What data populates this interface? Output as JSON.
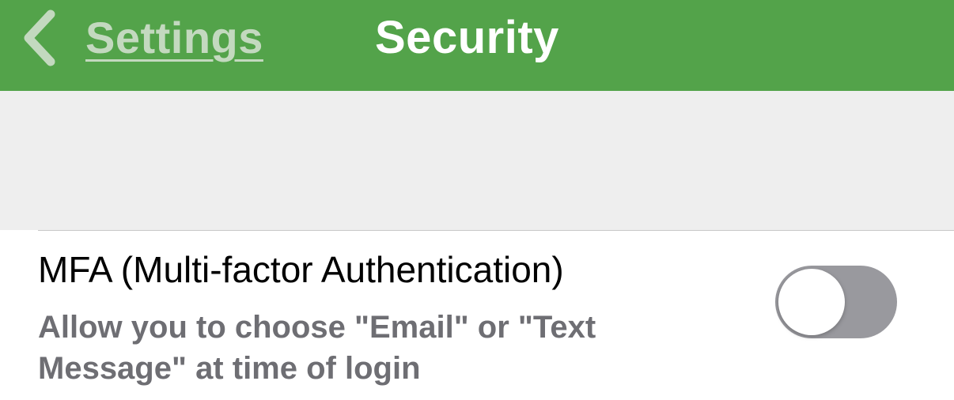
{
  "navbar": {
    "back_label": "Settings",
    "title": "Security",
    "background_color": "#53a34a",
    "back_icon": "chevron-left-icon"
  },
  "mfa": {
    "title": "MFA (Multi-factor Authentication)",
    "subtitle": "Allow you to choose \"Email\" or \"Text Message\" at time of login",
    "toggle_on": false,
    "toggle_off_color": "#99999e"
  }
}
